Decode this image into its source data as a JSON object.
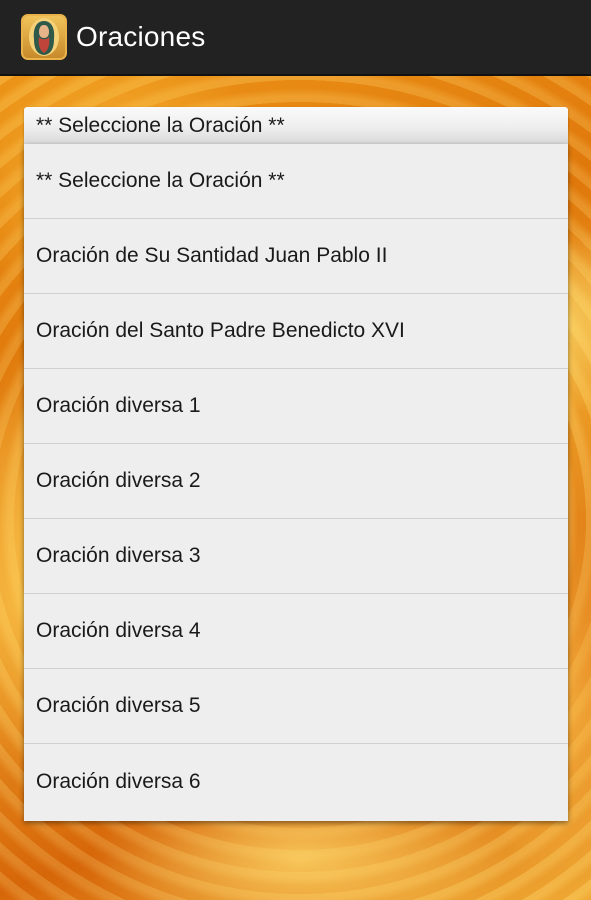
{
  "app": {
    "title": "Oraciones",
    "icon": "virgin-mary-icon"
  },
  "spinner": {
    "selected": "** Seleccione la Oración **"
  },
  "options": [
    "** Seleccione la Oración **",
    "Oración de Su Santidad Juan Pablo II",
    "Oración del Santo Padre Benedicto XVI",
    "Oración diversa 1",
    "Oración diversa 2",
    "Oración diversa 3",
    "Oración diversa 4",
    "Oración diversa 5",
    "Oración diversa 6"
  ],
  "colors": {
    "action_bar": "#222222",
    "list_background": "#eeeeee",
    "background_accent": "#e27b0c"
  }
}
